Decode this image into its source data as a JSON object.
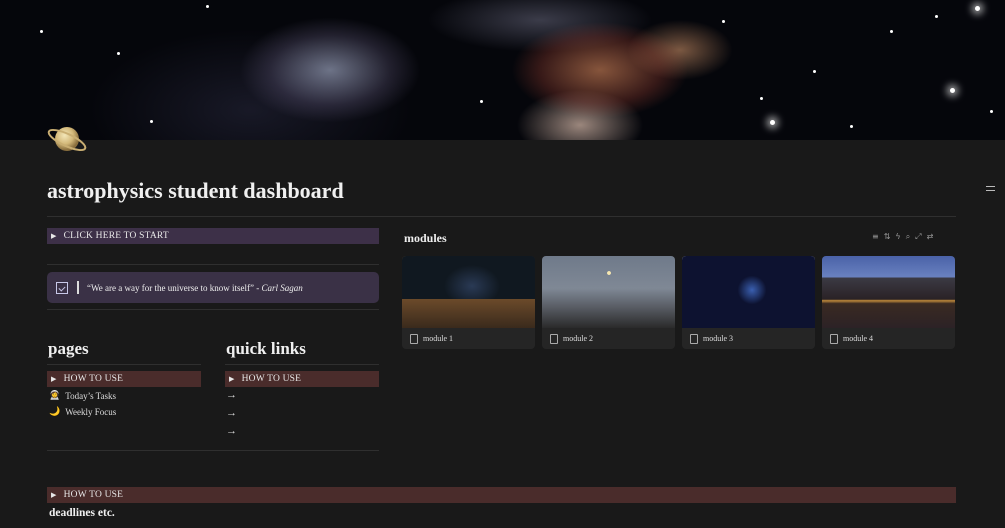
{
  "page": {
    "title": "astrophysics student dashboard",
    "icon": "saturn-icon"
  },
  "start_toggle": {
    "label": "CLICK HERE TO START"
  },
  "quote": {
    "text": "“We are a way for the universe to know itself”",
    "separator": " - ",
    "author": "Carl Sagan"
  },
  "pages": {
    "heading": "pages",
    "toggle_label": "HOW TO USE",
    "items": [
      {
        "emoji": "👩‍🚀",
        "label": "Today’s Tasks"
      },
      {
        "emoji": "🌙",
        "label": "Weekly Focus"
      }
    ]
  },
  "quick_links": {
    "heading": "quick links",
    "toggle_label": "HOW TO USE",
    "arrows": [
      "→",
      "→",
      "→"
    ]
  },
  "modules": {
    "title": "modules",
    "tools": [
      "filter-icon",
      "sort-icon",
      "lightning-icon",
      "search-icon",
      "expand-icon",
      "more-icon"
    ],
    "cards": [
      {
        "label": "module 1"
      },
      {
        "label": "module 2"
      },
      {
        "label": "module 3"
      },
      {
        "label": "module 4"
      }
    ]
  },
  "bottom_toggle": {
    "label": "HOW TO USE"
  },
  "deadlines": {
    "heading": "deadlines etc."
  },
  "colors": {
    "background": "#191919",
    "purple_block": "#3d3048",
    "brown_block": "#4a2c2b",
    "callout": "#3a3146"
  }
}
